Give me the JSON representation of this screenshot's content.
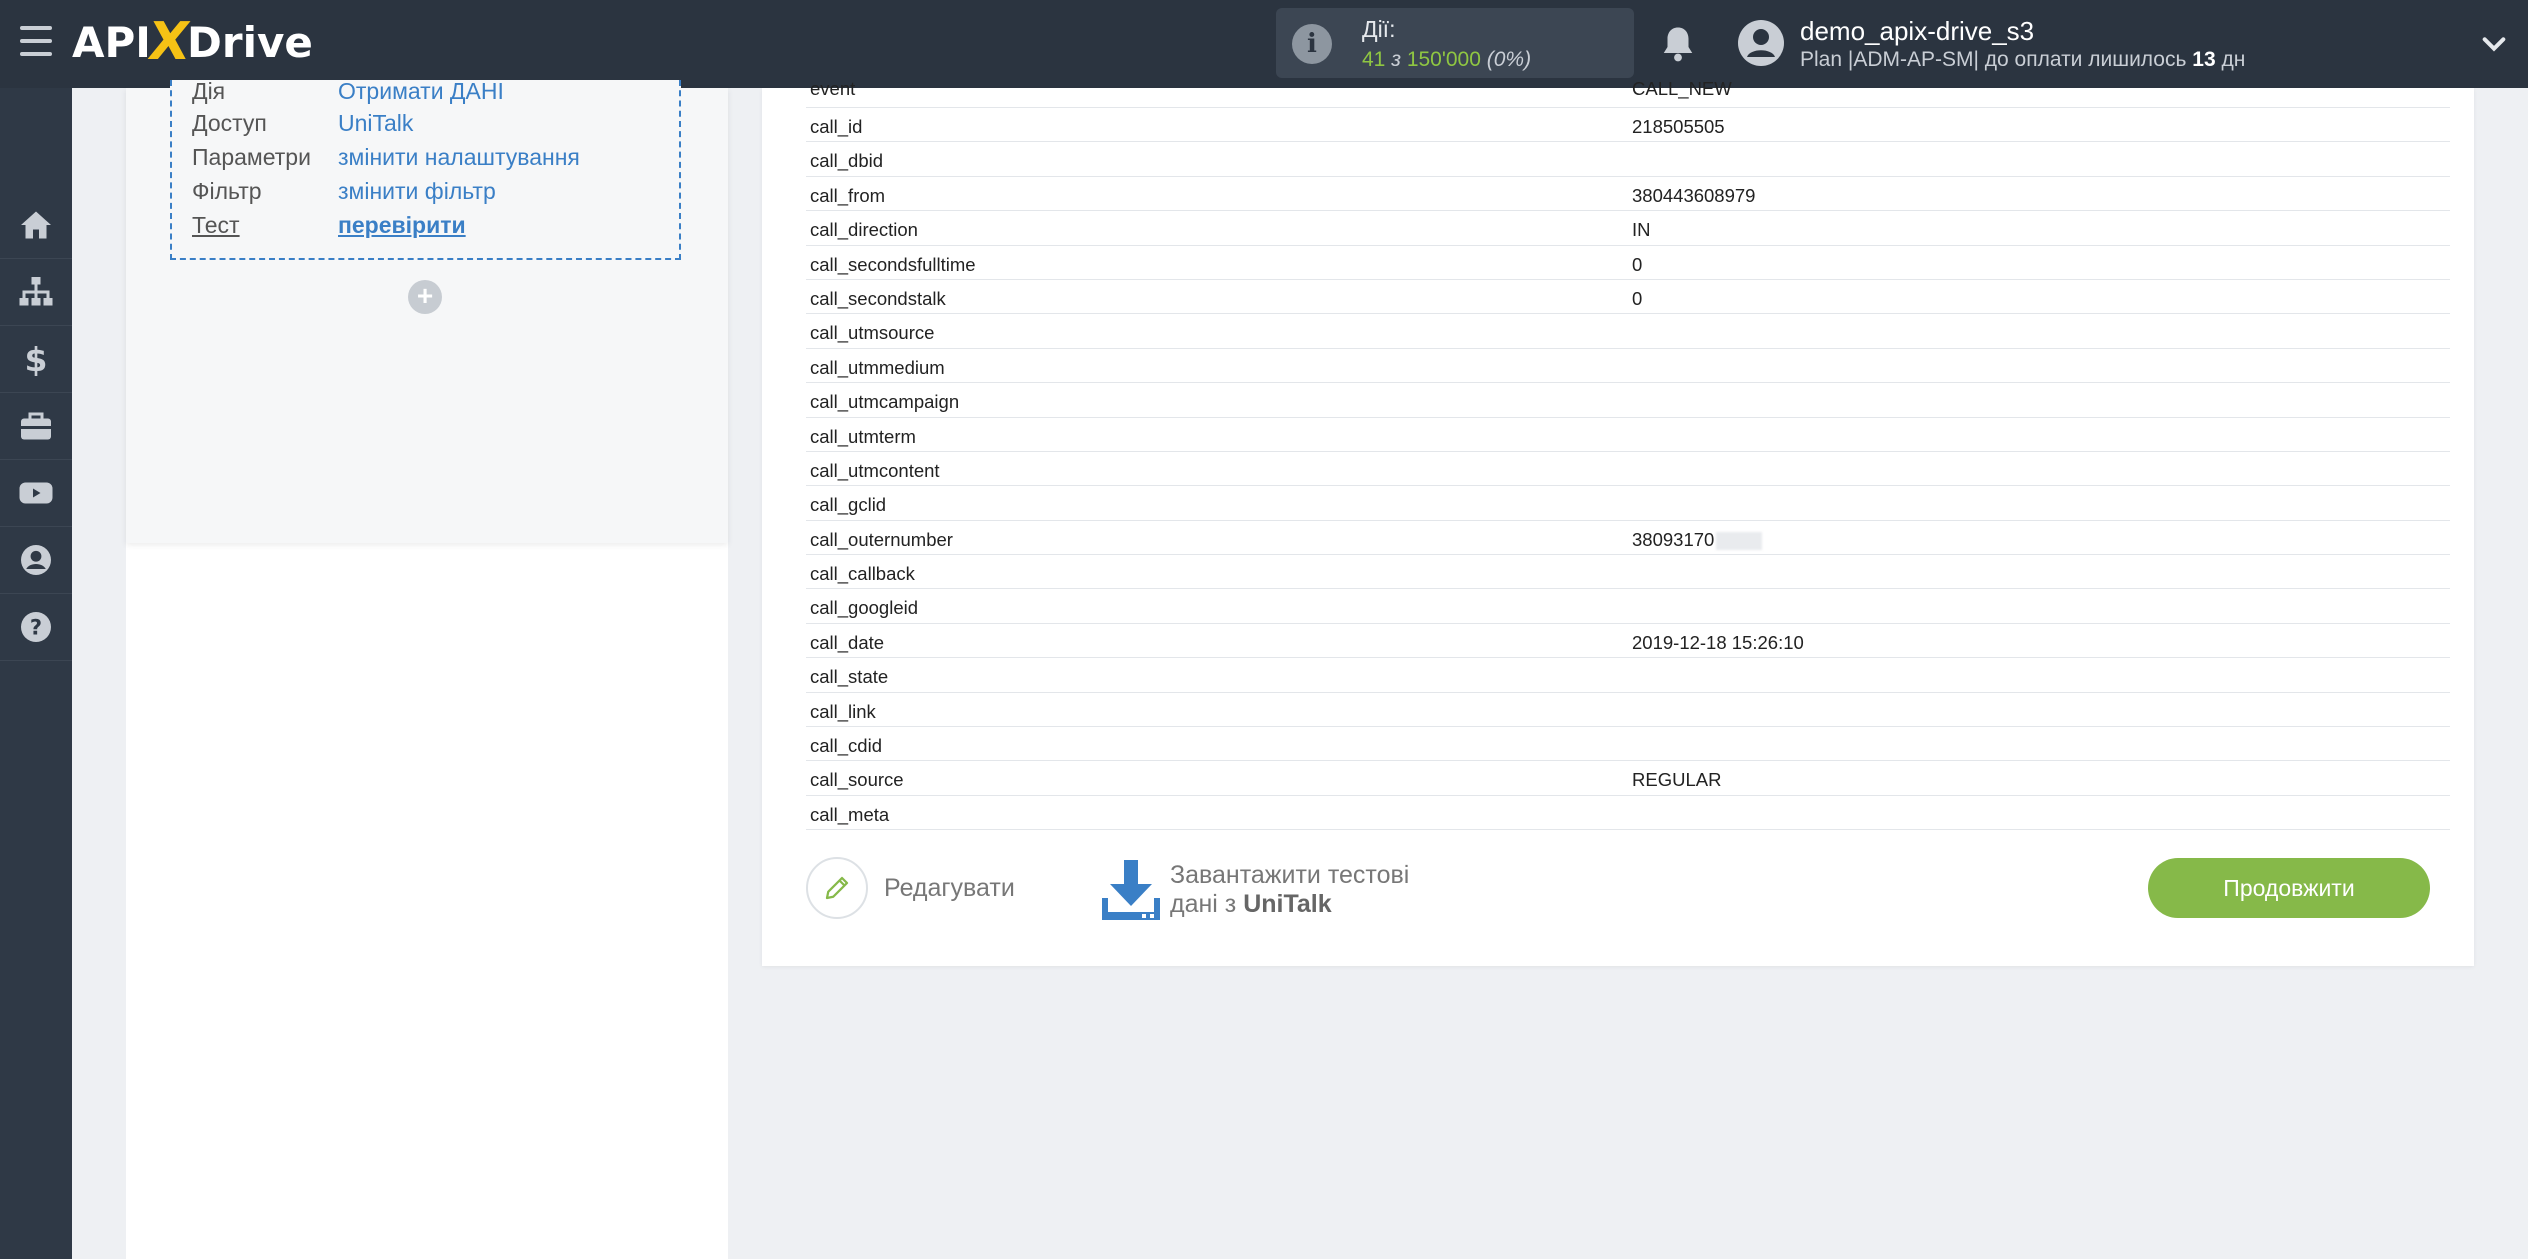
{
  "header": {
    "logo_api": "API",
    "logo_x": "X",
    "logo_drive": "Drive",
    "actions": {
      "label": "Дії:",
      "used": "41",
      "of": "з",
      "limit": "150'000",
      "percent": "(0%)"
    },
    "user": {
      "name": "demo_apix-drive_s3",
      "plan_prefix": "Plan |ADM-AP-SM| до оплати лишилось",
      "days": "13",
      "days_unit": "дн"
    }
  },
  "sidebar": {
    "items": [
      "home-icon",
      "sitemap-icon",
      "dollar-icon",
      "briefcase-icon",
      "youtube-icon",
      "user-icon",
      "help-icon"
    ]
  },
  "step": {
    "rows": [
      {
        "key": "Дія",
        "value": "Отримати ДАНІ"
      },
      {
        "key": "Доступ",
        "value": "UniTalk"
      },
      {
        "key": "Параметри",
        "value": "змінити налаштування"
      },
      {
        "key": "Фільтр",
        "value": "змінити фільтр"
      },
      {
        "key": "Тест",
        "value": "перевірити"
      }
    ],
    "add": "+"
  },
  "table": {
    "rows": [
      {
        "field": "event",
        "value": "CALL_NEW"
      },
      {
        "field": "call_id",
        "value": "218505505"
      },
      {
        "field": "call_dbid",
        "value": ""
      },
      {
        "field": "call_from",
        "value": "380443608979"
      },
      {
        "field": "call_direction",
        "value": "IN"
      },
      {
        "field": "call_secondsfulltime",
        "value": "0"
      },
      {
        "field": "call_secondstalk",
        "value": "0"
      },
      {
        "field": "call_utmsource",
        "value": ""
      },
      {
        "field": "call_utmmedium",
        "value": ""
      },
      {
        "field": "call_utmcampaign",
        "value": ""
      },
      {
        "field": "call_utmterm",
        "value": ""
      },
      {
        "field": "call_utmcontent",
        "value": ""
      },
      {
        "field": "call_gclid",
        "value": ""
      },
      {
        "field": "call_outernumber",
        "value": "38093170"
      },
      {
        "field": "call_callback",
        "value": ""
      },
      {
        "field": "call_googleid",
        "value": ""
      },
      {
        "field": "call_date",
        "value": "2019-12-18 15:26:10"
      },
      {
        "field": "call_state",
        "value": ""
      },
      {
        "field": "call_link",
        "value": ""
      },
      {
        "field": "call_cdid",
        "value": ""
      },
      {
        "field": "call_source",
        "value": "REGULAR"
      },
      {
        "field": "call_meta",
        "value": ""
      }
    ]
  },
  "buttons": {
    "edit": "Редагувати",
    "load_line1": "Завантажити тестові",
    "load_line2_prefix": "дані з",
    "load_service": "UniTalk",
    "next": "Продовжити"
  },
  "colors": {
    "topbar": "#2b3440",
    "accent_green": "#86b949",
    "link_blue": "#3a7fc6",
    "logo_x": "#f6c215"
  }
}
